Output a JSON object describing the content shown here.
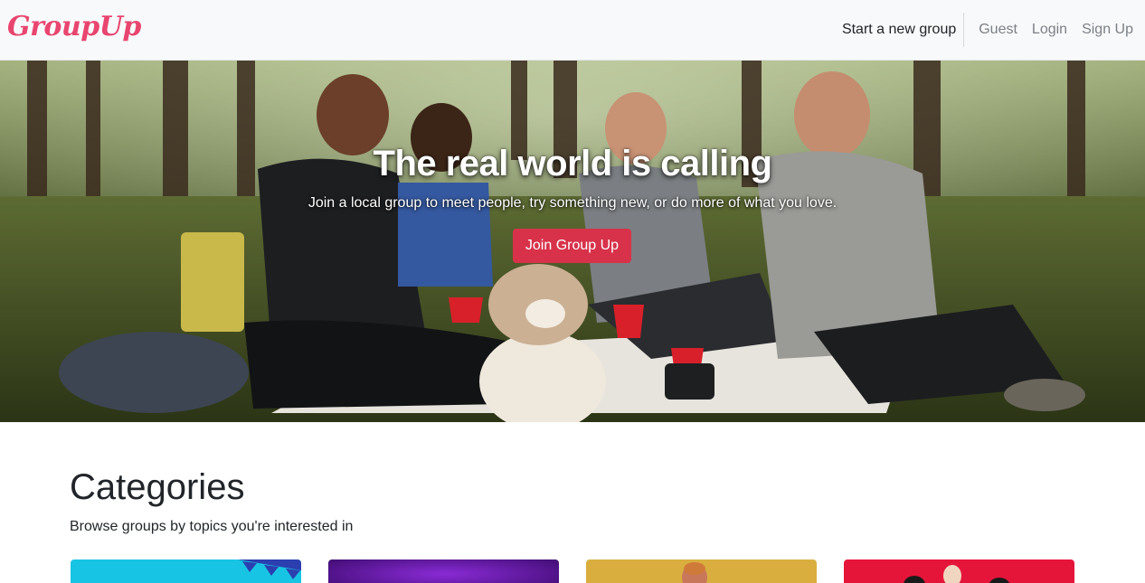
{
  "brand": {
    "name": "GroupUp"
  },
  "nav": {
    "start_group": "Start a new group",
    "guest": "Guest",
    "login": "Login",
    "signup": "Sign Up"
  },
  "hero": {
    "title": "The real world is calling",
    "subtitle": "Join a local group to meet people, try something new, or do more of what you love.",
    "cta": "Join Group Up"
  },
  "categories": {
    "heading": "Categories",
    "subheading": "Browse groups by topics you're interested in",
    "cards": [
      {
        "name": "category-card-1",
        "color": "#18c4e3"
      },
      {
        "name": "category-card-2",
        "color": "#5a1a8f"
      },
      {
        "name": "category-card-3",
        "color": "#d9ae3f"
      },
      {
        "name": "category-card-4",
        "color": "#e5153a"
      }
    ]
  },
  "colors": {
    "brand": "#e8456f",
    "cta": "#d7324a",
    "navbar_bg": "#f8f9fa"
  }
}
